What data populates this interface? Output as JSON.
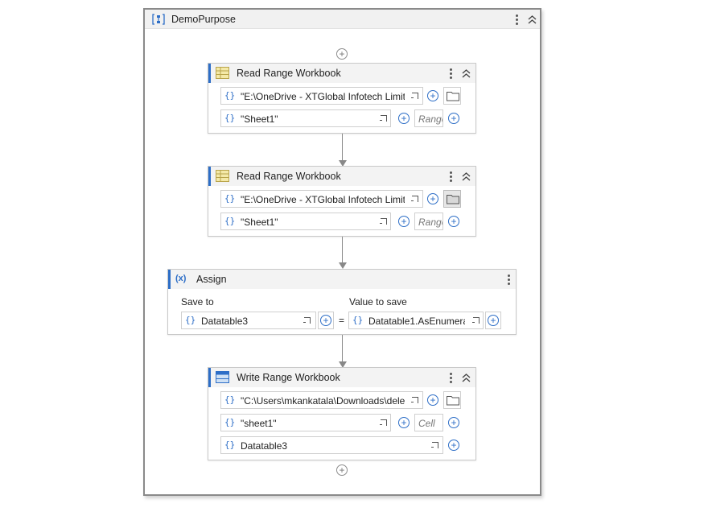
{
  "sequence": {
    "title": "DemoPurpose"
  },
  "activities": [
    {
      "title": "Read Range Workbook",
      "path": "\"E:\\OneDrive - XTGlobal Infotech Limit",
      "sheet": "\"Sheet1\"",
      "range_placeholder": "Range"
    },
    {
      "title": "Read Range Workbook",
      "path": "\"E:\\OneDrive - XTGlobal Infotech Limit",
      "sheet": "\"Sheet1\"",
      "range_placeholder": "Range"
    }
  ],
  "assign": {
    "icon_text": "(x)",
    "title": "Assign",
    "save_to_label": "Save to",
    "value_label": "Value to save",
    "save_to": "Datatable3",
    "equals": "=",
    "value": "Datatable1.AsEnumera"
  },
  "write": {
    "title": "Write Range Workbook",
    "path": "\"C:\\Users\\mkankatala\\Downloads\\dele",
    "sheet": "\"sheet1\"",
    "cell_placeholder": "Cell",
    "datatable": "Datatable3"
  },
  "common": {
    "brace": "{}",
    "plus": "+",
    "collapse": "⌃⌃"
  }
}
